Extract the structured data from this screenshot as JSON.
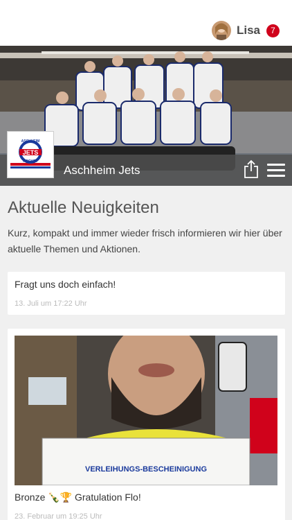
{
  "header": {
    "user_name": "Lisa",
    "notification_count": "7"
  },
  "club": {
    "name": "Aschheim Jets",
    "logo_text_top": "ASCHHEIM",
    "logo_text_main": "JETS",
    "logo_text_bottom": "HOCKEY"
  },
  "news": {
    "heading": "Aktuelle Neuigkeiten",
    "intro": "Kurz, kompakt und immer wieder frisch informieren wir hier über aktuelle Themen und Aktionen.",
    "posts": [
      {
        "text": "Fragt uns doch einfach!",
        "date": "13. Juli um 17:22 Uhr"
      },
      {
        "text": "Bronze 🍾🏆 Gratulation Flo!",
        "date": "23. Februar um 19:25 Uhr",
        "photo_caption": "VERLEIHUNGS-BESCHEINIGUNG"
      }
    ]
  },
  "icons": {
    "share": "share-icon",
    "menu": "hamburger-menu-icon"
  }
}
